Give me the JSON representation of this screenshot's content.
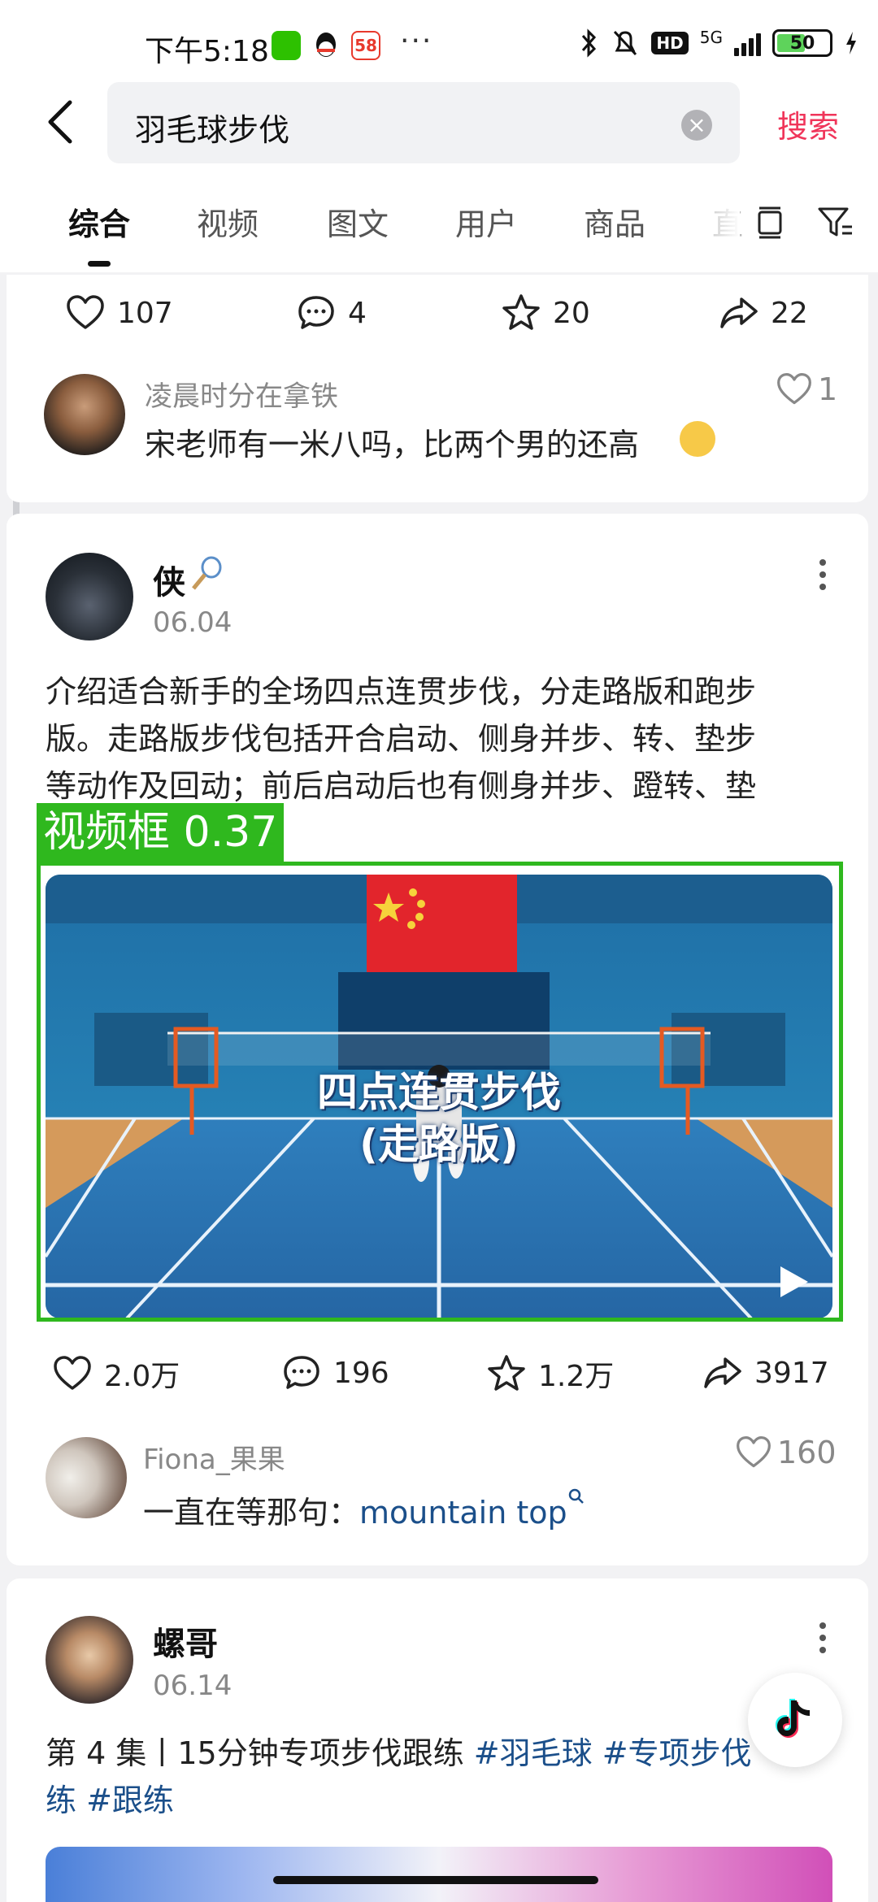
{
  "status_bar": {
    "time": "下午5:18",
    "network": "5G",
    "battery": "50",
    "colors": {
      "battery_fill": "#5ed35b",
      "wechat": "#2dc100",
      "app58": "#e8392c"
    }
  },
  "search": {
    "query": "羽毛球步伐",
    "submit_label": "搜索"
  },
  "tabs": [
    "综合",
    "视频",
    "图文",
    "用户",
    "商品",
    "直"
  ],
  "post1": {
    "actions": {
      "likes": "107",
      "comments": "4",
      "favorites": "20",
      "shares": "22"
    },
    "comment": {
      "user": "凌晨时分在拿铁",
      "text": "宋老师有一米八吗，比两个男的还高",
      "likes": "1"
    }
  },
  "post2": {
    "author": "侠",
    "date": "06.04",
    "text": [
      "介绍适合新手的全场四点连贯步伐，分走路版和跑步",
      "版。走路版步伐包括开合启动、侧身并步、转、垫步",
      "等动作及回动；前后启动后也有侧身并步、蹬转、垫"
    ],
    "detection_label": "视频框 0.37",
    "video_title": [
      "四点连贯步伐",
      "(走路版)"
    ],
    "actions": {
      "likes": "2.0万",
      "comments": "196",
      "favorites": "1.2万",
      "shares": "3917"
    },
    "comment": {
      "user": "Fiona_果果",
      "text_prefix": "一直在等那句：",
      "text_link": "mountain top",
      "likes": "160"
    }
  },
  "post3": {
    "author": "螺哥",
    "date": "06.14",
    "line1_prefix": "第 4 集丨15分钟专项步伐跟练 ",
    "line1_tags": "#羽毛球 #专项步伐",
    "line2_tags": "练 #跟练"
  },
  "colors": {
    "accent": "#f0355a",
    "hashtag": "#1b4f8a",
    "detection": "#2fb81e",
    "court": "#2a73b8",
    "flag": "#e2252c"
  }
}
